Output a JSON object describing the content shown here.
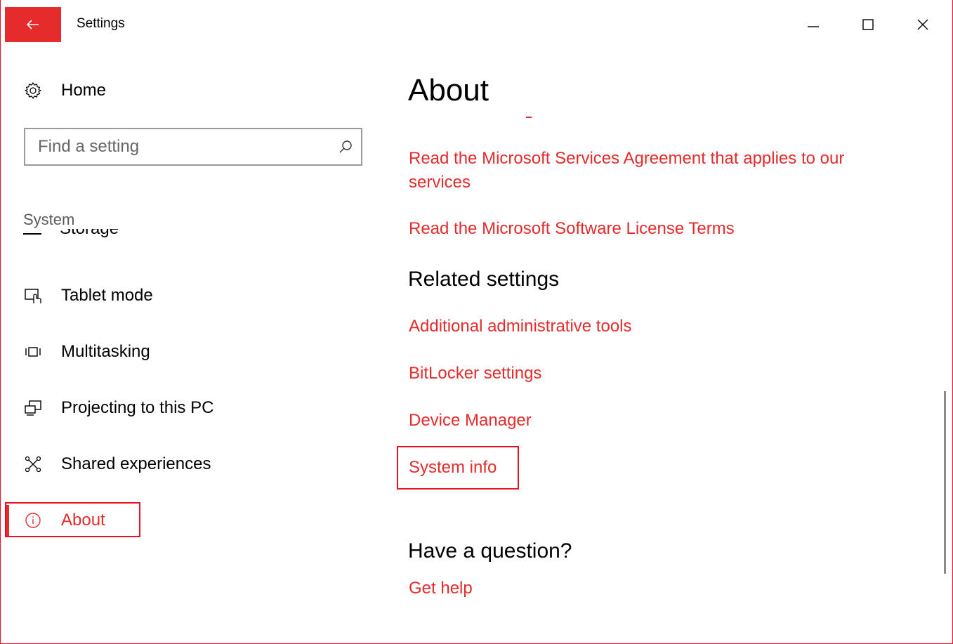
{
  "window": {
    "title": "Settings",
    "accent_color": "#e52b2b"
  },
  "sidebar": {
    "home_label": "Home",
    "search_placeholder": "Find a setting",
    "section_label": "System",
    "clipped_item_label": "Storage",
    "items": [
      {
        "label": "Tablet mode",
        "icon": "tablet-mode-icon"
      },
      {
        "label": "Multitasking",
        "icon": "multitasking-icon"
      },
      {
        "label": "Projecting to this PC",
        "icon": "projecting-icon"
      },
      {
        "label": "Shared experiences",
        "icon": "shared-experiences-icon"
      },
      {
        "label": "About",
        "icon": "info-icon",
        "selected": true
      }
    ]
  },
  "content": {
    "page_title": "About",
    "links_top": [
      "Read the Microsoft Services Agreement that applies to our services",
      "Read the Microsoft Software License Terms"
    ],
    "related_heading": "Related settings",
    "related_links": [
      "Additional administrative tools",
      "BitLocker settings",
      "Device Manager",
      "System info"
    ],
    "question_heading": "Have a question?",
    "help_link": "Get help"
  }
}
